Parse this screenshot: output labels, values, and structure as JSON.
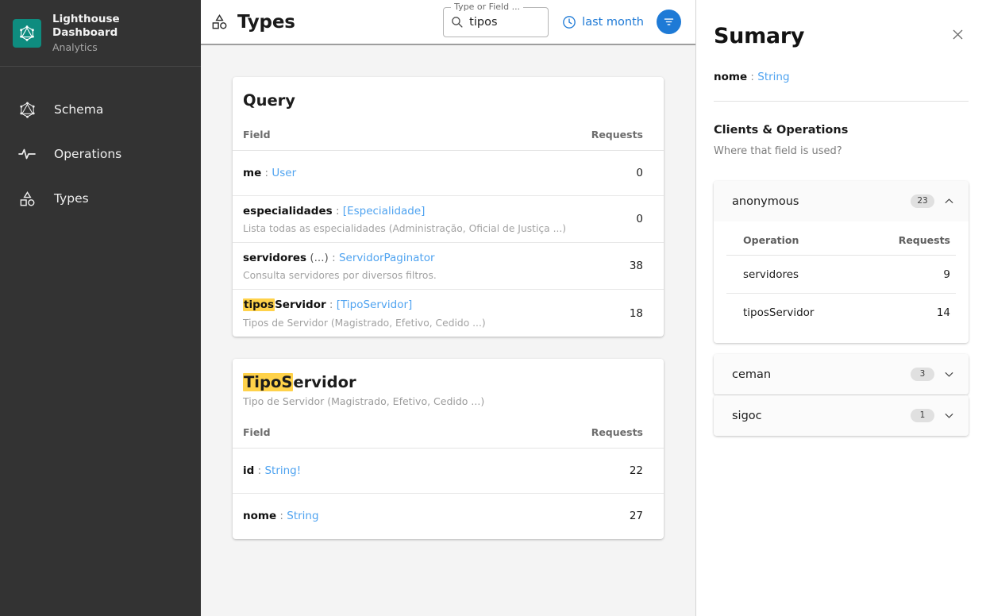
{
  "brand": {
    "logo_icon": "graphql-logo-icon",
    "title": "Lighthouse Dashboard",
    "subtitle": "Analytics",
    "logo_color": "#0e8c7f"
  },
  "sidebar": {
    "items": [
      {
        "label": "Schema",
        "icon": "graphql-logo-icon"
      },
      {
        "label": "Operations",
        "icon": "activity-pulse-icon"
      },
      {
        "label": "Types",
        "icon": "shapes-icon"
      }
    ]
  },
  "topbar": {
    "title": "Types",
    "title_icon": "shapes-icon",
    "search": {
      "legend": "Type or Field ...",
      "value": "tipos",
      "icon": "search-icon"
    },
    "time_range": {
      "label": "last month",
      "icon": "clock-icon",
      "color": "#1e7ad6"
    },
    "filter_button": {
      "icon": "filter-funnel-icon",
      "color": "#1e7ad6"
    }
  },
  "highlight_color": "#ffd24a",
  "cards": [
    {
      "title": "Query",
      "title_highlight": "",
      "description": "",
      "columns": {
        "field": "Field",
        "requests": "Requests"
      },
      "rows": [
        {
          "name": "me",
          "name_highlight": "",
          "args": "",
          "colon": ":",
          "type": "User",
          "description": "",
          "requests": "0"
        },
        {
          "name": "especialidades",
          "name_highlight": "",
          "args": "",
          "colon": ":",
          "type": "[Especialidade]",
          "description": "Lista todas as especialidades (Administração, Oficial de Justiça ...)",
          "requests": "0"
        },
        {
          "name": "servidores",
          "name_highlight": "",
          "args": "(...)",
          "colon": ":",
          "type": "ServidorPaginator",
          "description": "Consulta servidores por diversos filtros.",
          "requests": "38"
        },
        {
          "name": "tiposServidor",
          "name_highlight": "tipos",
          "args": "",
          "colon": ":",
          "type": "[TipoServidor]",
          "description": "Tipos de Servidor (Magistrado, Efetivo, Cedido ...)",
          "requests": "18"
        }
      ]
    },
    {
      "title": "TipoServidor",
      "title_highlight": "TipoS",
      "description": "Tipo de Servidor (Magistrado, Efetivo, Cedido ...)",
      "columns": {
        "field": "Field",
        "requests": "Requests"
      },
      "rows": [
        {
          "name": "id",
          "name_highlight": "",
          "args": "",
          "colon": ":",
          "type": "String!",
          "description": "",
          "requests": "22"
        },
        {
          "name": "nome",
          "name_highlight": "",
          "args": "",
          "colon": ":",
          "type": "String",
          "description": "",
          "requests": "27"
        }
      ]
    }
  ],
  "panel": {
    "title": "Sumary",
    "close_icon": "close-icon",
    "field": {
      "name": "nome",
      "colon": ":",
      "type": "String"
    },
    "section_title": "Clients & Operations",
    "section_subtitle": "Where that field is used?",
    "clients": [
      {
        "name": "anonymous",
        "badge": "23",
        "expanded": true,
        "chevron": "chevron-up-icon",
        "columns": {
          "operation": "Operation",
          "requests": "Requests"
        },
        "operations": [
          {
            "name": "servidores",
            "requests": "9"
          },
          {
            "name": "tiposServidor",
            "requests": "14"
          }
        ]
      },
      {
        "name": "ceman",
        "badge": "3",
        "expanded": false,
        "chevron": "chevron-down-icon",
        "columns": {
          "operation": "Operation",
          "requests": "Requests"
        },
        "operations": []
      },
      {
        "name": "sigoc",
        "badge": "1",
        "expanded": false,
        "chevron": "chevron-down-icon",
        "columns": {
          "operation": "Operation",
          "requests": "Requests"
        },
        "operations": []
      }
    ]
  }
}
